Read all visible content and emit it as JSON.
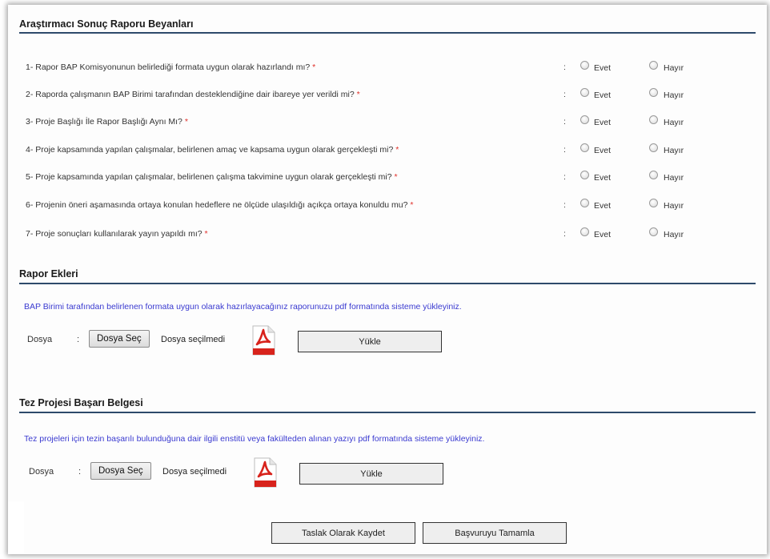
{
  "sections": {
    "beyanlar_title": "Araştırmacı Sonuç Raporu Beyanları",
    "ekler_title": "Rapor Ekleri",
    "tez_title": "Tez Projesi Başarı Belgesi"
  },
  "questions": [
    {
      "text": "1- Rapor BAP Komisyonunun belirlediği formata uygun olarak hazırlandı mı?",
      "required": "*"
    },
    {
      "text": "2- Raporda çalışmanın BAP Birimi tarafından desteklendiğine dair ibareye yer verildi mi?",
      "required": "*"
    },
    {
      "text": "3- Proje Başlığı İle Rapor Başlığı Aynı Mı?",
      "required": "*"
    },
    {
      "text": "4- Proje kapsamında yapılan çalışmalar, belirlenen amaç ve kapsama uygun olarak gerçekleşti mi?",
      "required": "*"
    },
    {
      "text": "5- Proje kapsamında yapılan çalışmalar, belirlenen çalışma takvimine uygun olarak gerçekleşti mi?",
      "required": "*"
    },
    {
      "text": "6- Projenin öneri aşamasında ortaya konulan hedeflere ne ölçüde ulaşıldığı açıkça ortaya konuldu mu?",
      "required": "*"
    },
    {
      "text": "7- Proje sonuçları kullanılarak yayın yapıldı mı?",
      "required": "*"
    }
  ],
  "answer": {
    "colon": ":",
    "yes": "Evet",
    "no": "Hayır"
  },
  "rapor_ekleri": {
    "info": "BAP Birimi tarafından belirlenen formata uygun olarak hazırlayacağınız raporunuzu pdf formatında sisteme yükleyiniz.",
    "file_label": "Dosya",
    "colon": ":",
    "choose_button": "Dosya Seç",
    "status": "Dosya seçilmedi",
    "upload_button": "Yükle"
  },
  "tez_belgesi": {
    "info": "Tez projeleri için tezin başarılı bulunduğuna dair ilgili enstitü veya fakülteden alınan yazıyı pdf formatında sisteme yükleyiniz.",
    "file_label": "Dosya",
    "colon": ":",
    "choose_button": "Dosya Seç",
    "status": "Dosya seçilmedi",
    "upload_button": "Yükle"
  },
  "actions": {
    "draft_button": "Taslak Olarak Kaydet",
    "complete_button": "Başvuruyu Tamamla"
  },
  "colors": {
    "section_line": "#2e4a6b",
    "info_text": "#3a3ad0",
    "required_mark": "#e0302a",
    "pdf_red": "#d8231c"
  },
  "icons": {
    "pdf": "pdf-file-icon"
  }
}
